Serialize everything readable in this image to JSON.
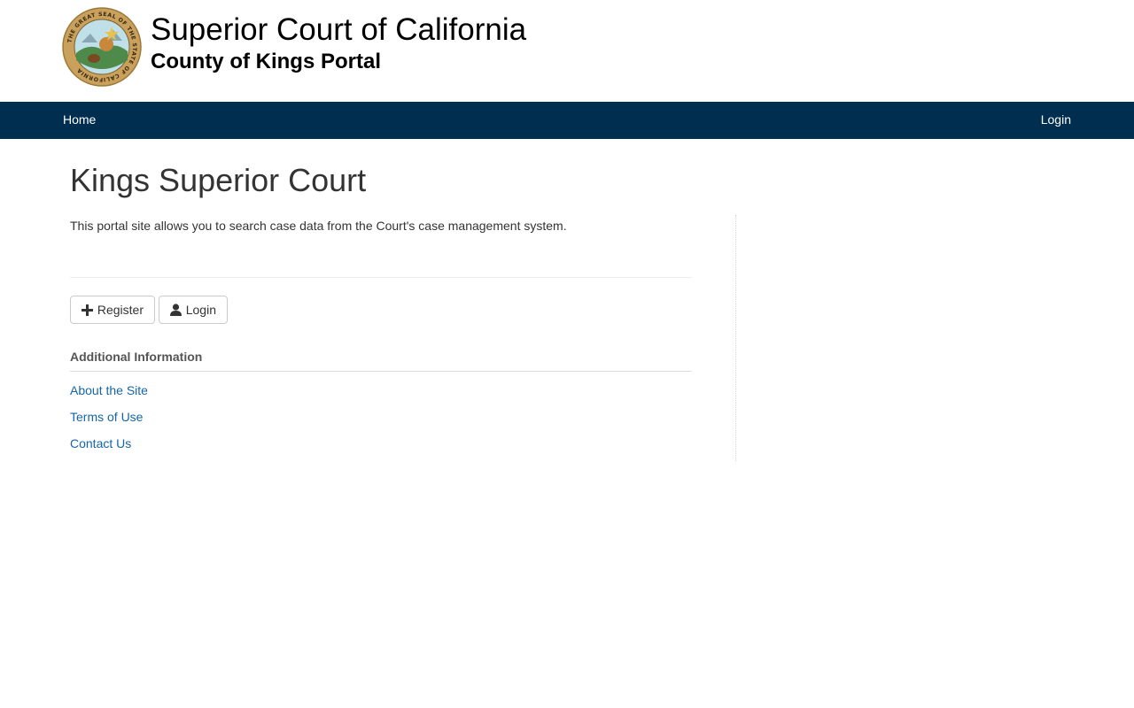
{
  "header": {
    "title": "Superior Court of California",
    "subtitle": "County of Kings Portal",
    "seal_icon": "california-state-seal",
    "seal_text": "THE GREAT SEAL OF THE STATE OF CALIFORNIA"
  },
  "navbar": {
    "home_label": "Home",
    "login_label": "Login",
    "background": "#002e50"
  },
  "main": {
    "page_title": "Kings Superior Court",
    "intro_text": "This portal site allows you to search case data from the Court's case management system.",
    "buttons": {
      "register_label": "Register",
      "register_icon": "plus-icon",
      "login_label": "Login",
      "login_icon": "user-icon"
    },
    "additional_info": {
      "heading": "Additional Information",
      "links": [
        {
          "label": "About the Site"
        },
        {
          "label": "Terms of Use"
        },
        {
          "label": "Contact Us"
        }
      ]
    }
  },
  "colors": {
    "link": "#1565a8",
    "nav_text": "#ffffff",
    "body_text": "#333333"
  }
}
